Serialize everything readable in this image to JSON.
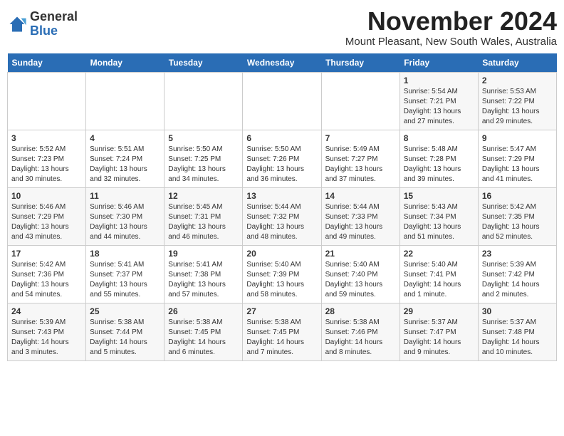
{
  "header": {
    "logo_general": "General",
    "logo_blue": "Blue",
    "month_title": "November 2024",
    "subtitle": "Mount Pleasant, New South Wales, Australia"
  },
  "days_of_week": [
    "Sunday",
    "Monday",
    "Tuesday",
    "Wednesday",
    "Thursday",
    "Friday",
    "Saturday"
  ],
  "weeks": [
    [
      {
        "day": "",
        "info": ""
      },
      {
        "day": "",
        "info": ""
      },
      {
        "day": "",
        "info": ""
      },
      {
        "day": "",
        "info": ""
      },
      {
        "day": "",
        "info": ""
      },
      {
        "day": "1",
        "info": "Sunrise: 5:54 AM\nSunset: 7:21 PM\nDaylight: 13 hours and 27 minutes."
      },
      {
        "day": "2",
        "info": "Sunrise: 5:53 AM\nSunset: 7:22 PM\nDaylight: 13 hours and 29 minutes."
      }
    ],
    [
      {
        "day": "3",
        "info": "Sunrise: 5:52 AM\nSunset: 7:23 PM\nDaylight: 13 hours and 30 minutes."
      },
      {
        "day": "4",
        "info": "Sunrise: 5:51 AM\nSunset: 7:24 PM\nDaylight: 13 hours and 32 minutes."
      },
      {
        "day": "5",
        "info": "Sunrise: 5:50 AM\nSunset: 7:25 PM\nDaylight: 13 hours and 34 minutes."
      },
      {
        "day": "6",
        "info": "Sunrise: 5:50 AM\nSunset: 7:26 PM\nDaylight: 13 hours and 36 minutes."
      },
      {
        "day": "7",
        "info": "Sunrise: 5:49 AM\nSunset: 7:27 PM\nDaylight: 13 hours and 37 minutes."
      },
      {
        "day": "8",
        "info": "Sunrise: 5:48 AM\nSunset: 7:28 PM\nDaylight: 13 hours and 39 minutes."
      },
      {
        "day": "9",
        "info": "Sunrise: 5:47 AM\nSunset: 7:29 PM\nDaylight: 13 hours and 41 minutes."
      }
    ],
    [
      {
        "day": "10",
        "info": "Sunrise: 5:46 AM\nSunset: 7:29 PM\nDaylight: 13 hours and 43 minutes."
      },
      {
        "day": "11",
        "info": "Sunrise: 5:46 AM\nSunset: 7:30 PM\nDaylight: 13 hours and 44 minutes."
      },
      {
        "day": "12",
        "info": "Sunrise: 5:45 AM\nSunset: 7:31 PM\nDaylight: 13 hours and 46 minutes."
      },
      {
        "day": "13",
        "info": "Sunrise: 5:44 AM\nSunset: 7:32 PM\nDaylight: 13 hours and 48 minutes."
      },
      {
        "day": "14",
        "info": "Sunrise: 5:44 AM\nSunset: 7:33 PM\nDaylight: 13 hours and 49 minutes."
      },
      {
        "day": "15",
        "info": "Sunrise: 5:43 AM\nSunset: 7:34 PM\nDaylight: 13 hours and 51 minutes."
      },
      {
        "day": "16",
        "info": "Sunrise: 5:42 AM\nSunset: 7:35 PM\nDaylight: 13 hours and 52 minutes."
      }
    ],
    [
      {
        "day": "17",
        "info": "Sunrise: 5:42 AM\nSunset: 7:36 PM\nDaylight: 13 hours and 54 minutes."
      },
      {
        "day": "18",
        "info": "Sunrise: 5:41 AM\nSunset: 7:37 PM\nDaylight: 13 hours and 55 minutes."
      },
      {
        "day": "19",
        "info": "Sunrise: 5:41 AM\nSunset: 7:38 PM\nDaylight: 13 hours and 57 minutes."
      },
      {
        "day": "20",
        "info": "Sunrise: 5:40 AM\nSunset: 7:39 PM\nDaylight: 13 hours and 58 minutes."
      },
      {
        "day": "21",
        "info": "Sunrise: 5:40 AM\nSunset: 7:40 PM\nDaylight: 13 hours and 59 minutes."
      },
      {
        "day": "22",
        "info": "Sunrise: 5:40 AM\nSunset: 7:41 PM\nDaylight: 14 hours and 1 minute."
      },
      {
        "day": "23",
        "info": "Sunrise: 5:39 AM\nSunset: 7:42 PM\nDaylight: 14 hours and 2 minutes."
      }
    ],
    [
      {
        "day": "24",
        "info": "Sunrise: 5:39 AM\nSunset: 7:43 PM\nDaylight: 14 hours and 3 minutes."
      },
      {
        "day": "25",
        "info": "Sunrise: 5:38 AM\nSunset: 7:44 PM\nDaylight: 14 hours and 5 minutes."
      },
      {
        "day": "26",
        "info": "Sunrise: 5:38 AM\nSunset: 7:45 PM\nDaylight: 14 hours and 6 minutes."
      },
      {
        "day": "27",
        "info": "Sunrise: 5:38 AM\nSunset: 7:45 PM\nDaylight: 14 hours and 7 minutes."
      },
      {
        "day": "28",
        "info": "Sunrise: 5:38 AM\nSunset: 7:46 PM\nDaylight: 14 hours and 8 minutes."
      },
      {
        "day": "29",
        "info": "Sunrise: 5:37 AM\nSunset: 7:47 PM\nDaylight: 14 hours and 9 minutes."
      },
      {
        "day": "30",
        "info": "Sunrise: 5:37 AM\nSunset: 7:48 PM\nDaylight: 14 hours and 10 minutes."
      }
    ]
  ]
}
